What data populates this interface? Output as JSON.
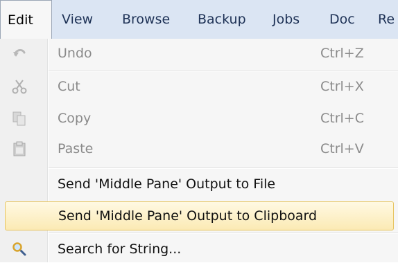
{
  "menubar": {
    "items": [
      "Edit",
      "View",
      "Browse",
      "Backup",
      "Jobs",
      "Doc",
      "Re"
    ]
  },
  "menu": {
    "undo": {
      "label": "Undo",
      "shortcut": "Ctrl+Z",
      "icon": "undo-icon"
    },
    "cut": {
      "label": "Cut",
      "shortcut": "Ctrl+X",
      "icon": "scissors-icon"
    },
    "copy": {
      "label": "Copy",
      "shortcut": "Ctrl+C",
      "icon": "copy-icon"
    },
    "paste": {
      "label": "Paste",
      "shortcut": "Ctrl+V",
      "icon": "clipboard-icon"
    },
    "send_file": {
      "label": "Send 'Middle Pane' Output to File"
    },
    "send_clipboard": {
      "label": "Send 'Middle Pane' Output to Clipboard"
    },
    "search": {
      "label": "Search for String...",
      "icon": "magnifier-icon"
    }
  },
  "colors": {
    "menubar_bg": "#dbe5f3",
    "highlight_border": "#e7c562",
    "highlight_fill": "#fbeab4",
    "disabled_text": "#8a8a8a"
  }
}
